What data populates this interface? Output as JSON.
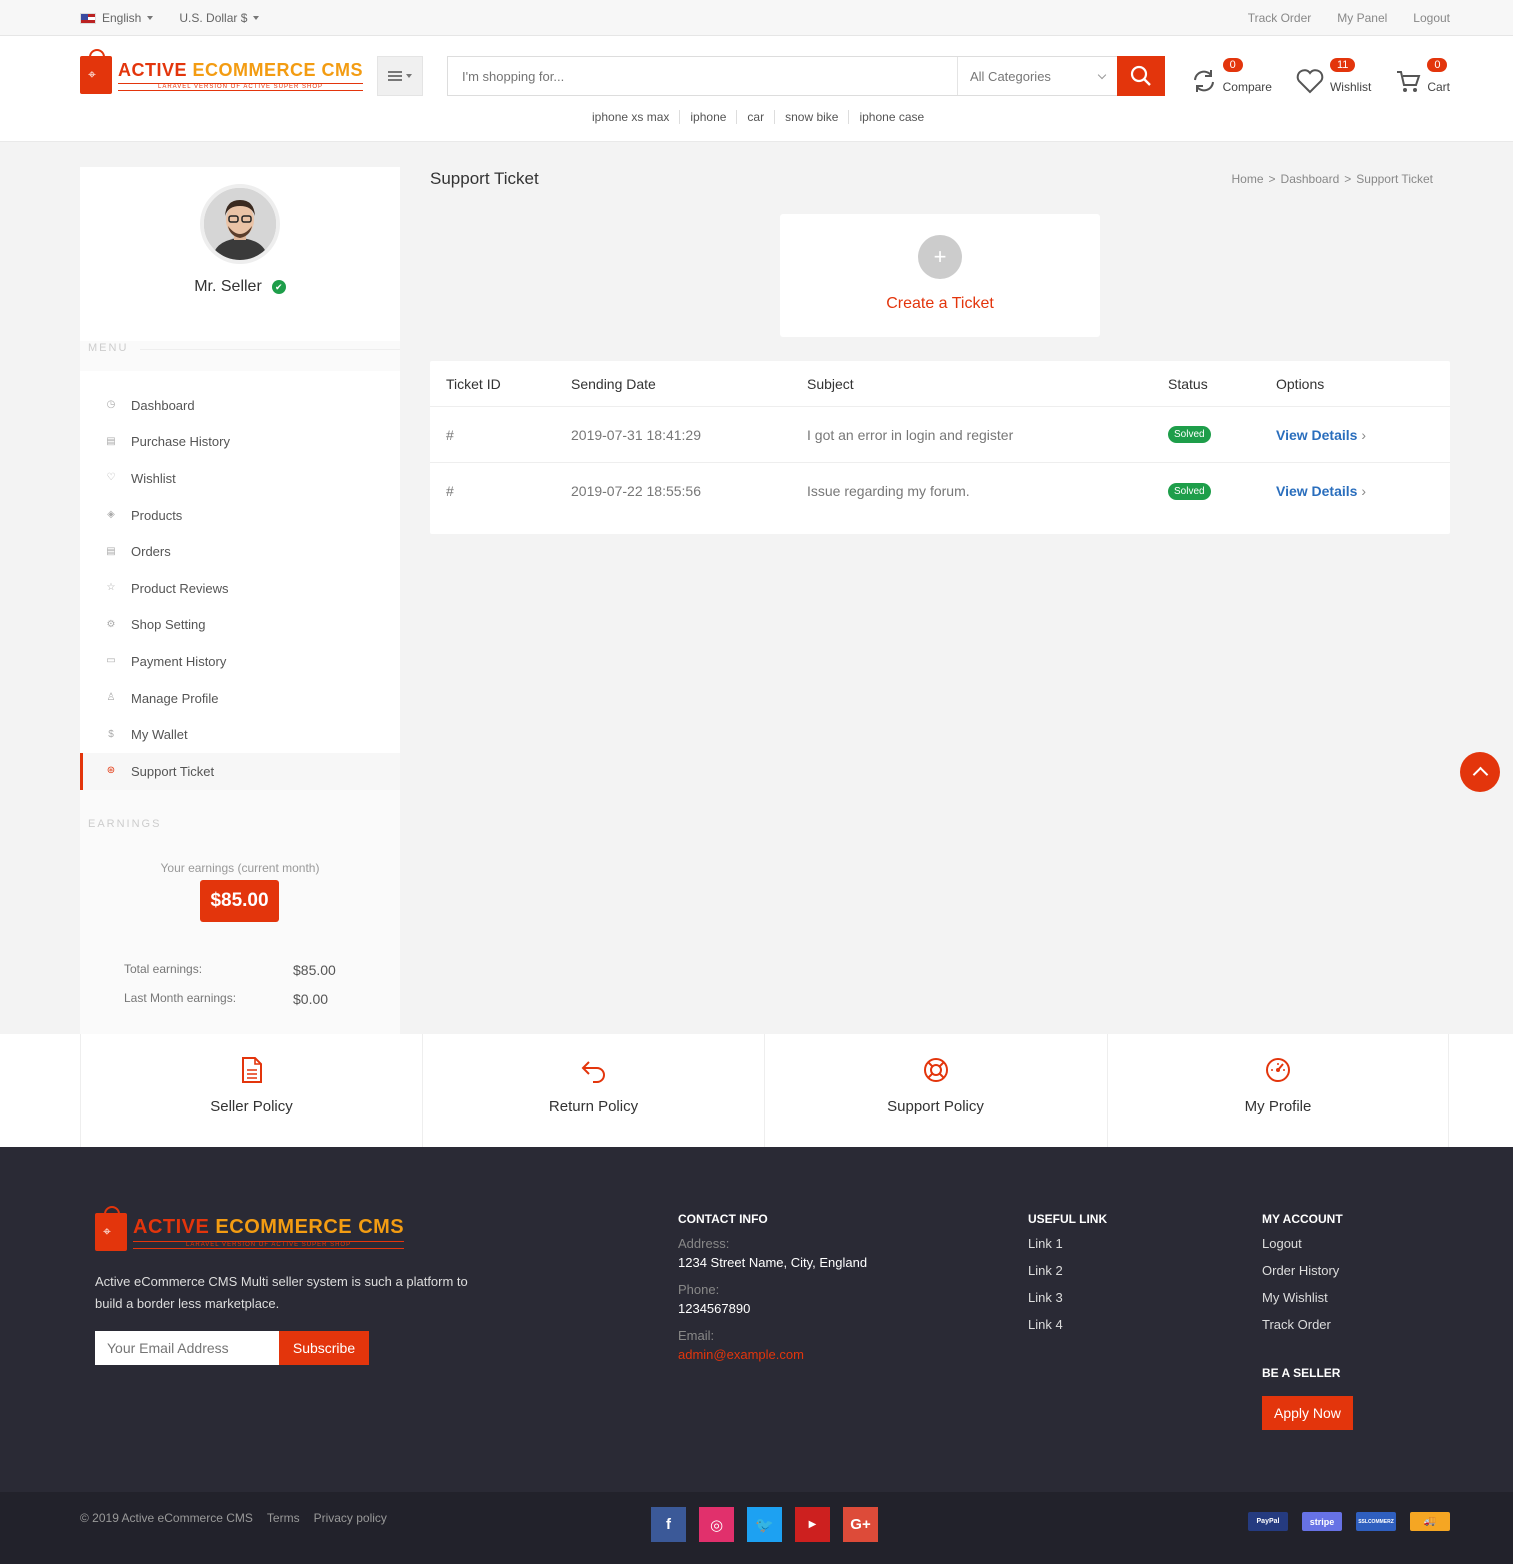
{
  "topbar": {
    "language": "English",
    "currency": "U.S. Dollar $",
    "links": [
      "Track Order",
      "My Panel",
      "Logout"
    ]
  },
  "brand": {
    "name_part1": "ACTIVE ",
    "name_part2": "ECOMMERCE CMS",
    "tagline": "LARAVEL VERSION OF ACTIVE SUPER SHOP"
  },
  "search": {
    "placeholder": "I'm shopping for...",
    "category": "All Categories",
    "tags": [
      "iphone xs max",
      "iphone",
      "car",
      "snow bike",
      "iphone case"
    ]
  },
  "header_icons": {
    "compare": {
      "label": "Compare",
      "count": "0"
    },
    "wishlist": {
      "label": "Wishlist",
      "count": "11"
    },
    "cart": {
      "label": "Cart",
      "count": "0"
    }
  },
  "colors": {
    "accent": "#e3350c",
    "success": "#1e9e4a",
    "link": "#2a6ebd",
    "footer": "#2a2a35"
  },
  "sidebar": {
    "user_name": "Mr. Seller",
    "menu_label": "MENU",
    "items": [
      {
        "label": "Dashboard",
        "icon": "dashboard-icon"
      },
      {
        "label": "Purchase History",
        "icon": "file-icon"
      },
      {
        "label": "Wishlist",
        "icon": "heart-icon"
      },
      {
        "label": "Products",
        "icon": "diamond-icon"
      },
      {
        "label": "Orders",
        "icon": "file-icon"
      },
      {
        "label": "Product Reviews",
        "icon": "star-icon"
      },
      {
        "label": "Shop Setting",
        "icon": "gear-icon"
      },
      {
        "label": "Payment History",
        "icon": "money-icon"
      },
      {
        "label": "Manage Profile",
        "icon": "user-icon"
      },
      {
        "label": "My Wallet",
        "icon": "dollar-icon"
      },
      {
        "label": "Support Ticket",
        "icon": "lifebuoy-icon"
      }
    ],
    "earnings_label": "EARNINGS",
    "earnings_heading": "Your earnings (current month)",
    "earnings_amount": "$85.00",
    "total_label": "Total earnings:",
    "total_value": "$85.00",
    "last_month_label": "Last Month earnings:",
    "last_month_value": "$0.00"
  },
  "main": {
    "title": "Support Ticket",
    "breadcrumb": [
      "Home",
      "Dashboard",
      "Support Ticket"
    ],
    "create_label": "Create a Ticket",
    "create_plus": "+",
    "table": {
      "headers": [
        "Ticket ID",
        "Sending Date",
        "Subject",
        "Status",
        "Options"
      ],
      "rows": [
        {
          "id": "#",
          "date": "2019-07-31 18:41:29",
          "subject": "I got an error in login and register",
          "status": "Solved",
          "option": "View Details"
        },
        {
          "id": "#",
          "date": "2019-07-22 18:55:56",
          "subject": "Issue regarding my forum.",
          "status": "Solved",
          "option": "View Details"
        }
      ]
    }
  },
  "policies": [
    "Seller Policy",
    "Return Policy",
    "Support Policy",
    "My Profile"
  ],
  "footer": {
    "description": "Active eCommerce CMS Multi seller system is such a platform to build a border less marketplace.",
    "email_placeholder": "Your Email Address",
    "subscribe": "Subscribe",
    "contact": {
      "title": "CONTACT INFO",
      "address_label": "Address:",
      "address": "1234 Street Name, City, England",
      "phone_label": "Phone:",
      "phone": "1234567890",
      "email_label": "Email:",
      "email": "admin@example.com"
    },
    "useful": {
      "title": "USEFUL LINK",
      "links": [
        "Link 1",
        "Link 2",
        "Link 3",
        "Link 4"
      ]
    },
    "account": {
      "title": "MY ACCOUNT",
      "links": [
        "Logout",
        "Order History",
        "My Wishlist",
        "Track Order"
      ]
    },
    "seller": {
      "title": "BE A SELLER",
      "button": "Apply Now"
    },
    "copyright": "© 2019 Active eCommerce CMS",
    "terms": "Terms",
    "privacy": "Privacy policy",
    "socials": [
      "facebook-icon",
      "instagram-icon",
      "twitter-icon",
      "youtube-icon",
      "google-plus-icon"
    ],
    "payments": [
      "PayPal",
      "stripe",
      "SSLCOMMERZ",
      "cash-on-delivery-icon"
    ]
  }
}
